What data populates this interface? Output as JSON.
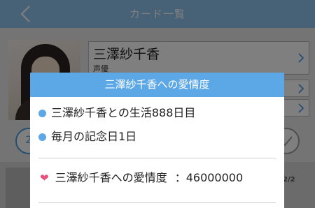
{
  "navbar": {
    "title": "カード一覧",
    "background_color": "#8fc4ef"
  },
  "card": {
    "name": "三澤紗千香",
    "role": "声優"
  },
  "buttons": {
    "left_round_label": "2"
  },
  "bottom": {
    "pager_text": "2/2"
  },
  "dialog": {
    "title": "三澤紗千香への愛情度",
    "header_color": "#5ca7e5",
    "lines": [
      {
        "text": "三澤紗千香との生活888日目",
        "icon": "bullet-dot-icon"
      },
      {
        "text": "毎月の記念日1日",
        "icon": "bullet-dot-icon"
      }
    ],
    "affection": {
      "icon": "heart-icon",
      "label": "三澤紗千香への愛情度",
      "separator": "：",
      "value": "46000000",
      "accent_color": "#e84f7c"
    }
  }
}
